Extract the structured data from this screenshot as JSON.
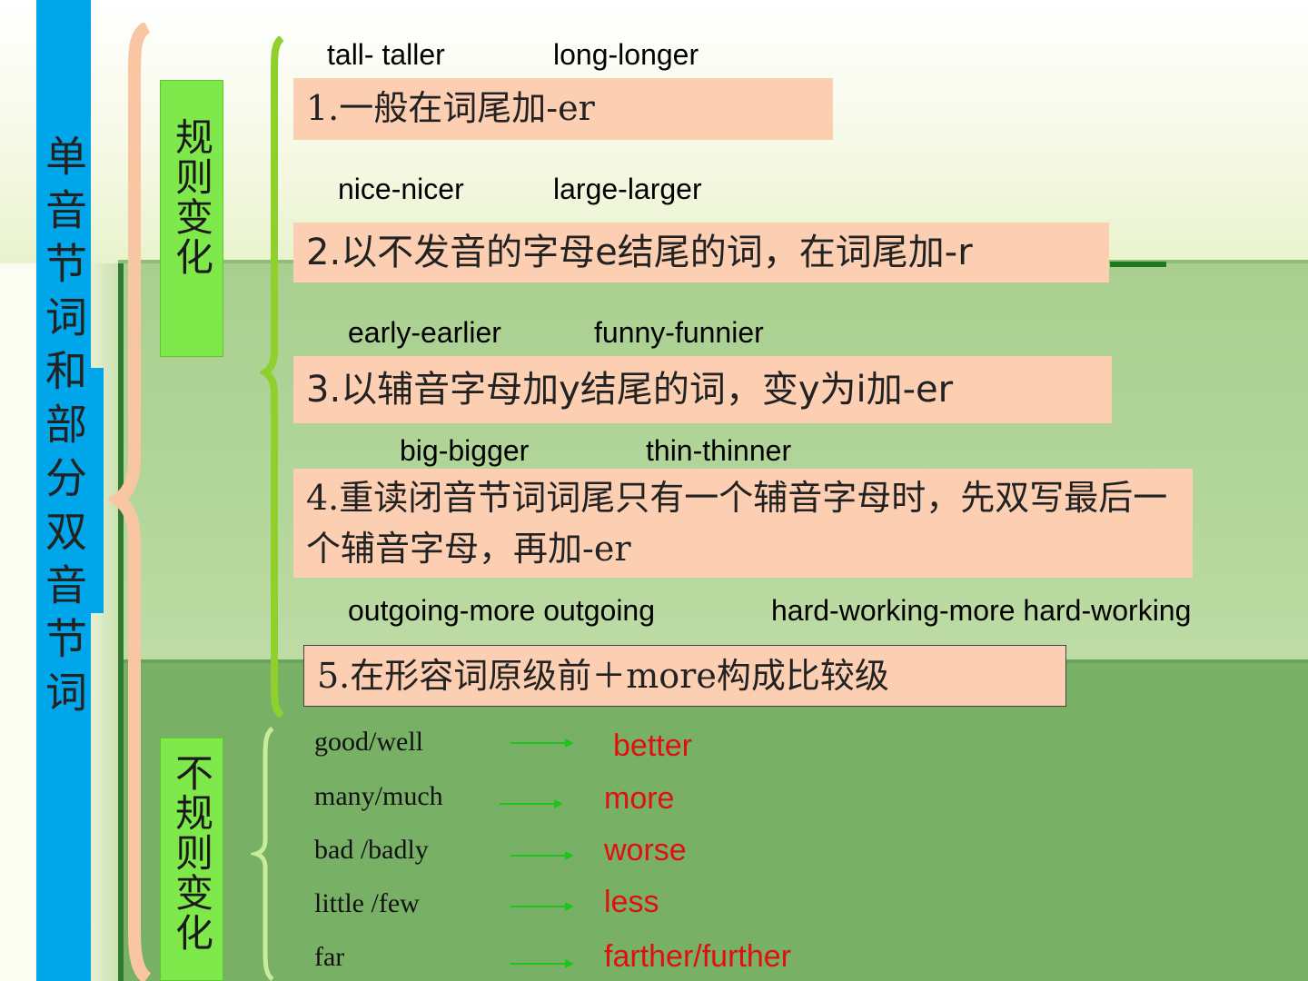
{
  "title": "单音节词和部分双音节词",
  "categories": {
    "regular": "规则变化",
    "irregular": "不规则变化"
  },
  "rules": [
    {
      "text": "1.一般在词尾加-er",
      "examples": [
        "tall- taller",
        "long-longer"
      ]
    },
    {
      "text": "2.以不发音的字母e结尾的词，在词尾加-r",
      "examples": [
        "nice-nicer",
        "large-larger"
      ]
    },
    {
      "text": "3.以辅音字母加y结尾的词，变y为i加-er",
      "examples": [
        "early-earlier",
        "funny-funnier"
      ]
    },
    {
      "text": "4.重读闭音节词词尾只有一个辅音字母时，先双写最后一个辅音字母，再加-er",
      "examples": [
        "big-bigger",
        "thin-thinner"
      ]
    },
    {
      "text": "5.在形容词原级前＋more构成比较级",
      "examples": [
        "outgoing-more outgoing",
        "hard-working-more hard-working"
      ]
    }
  ],
  "irregular": [
    {
      "word": "good/well",
      "comparative": "better"
    },
    {
      "word": "many/much",
      "comparative": "more"
    },
    {
      "word": "bad /badly",
      "comparative": "worse"
    },
    {
      "word": "little /few",
      "comparative": "less"
    },
    {
      "word": "far",
      "comparative": "farther/further"
    }
  ],
  "colors": {
    "title_bar": "#00a6ea",
    "category_box": "#7fe84a",
    "rule_box": "#fdcfb2",
    "irregular_result": "#e01010",
    "arrow": "#1ec41e"
  }
}
